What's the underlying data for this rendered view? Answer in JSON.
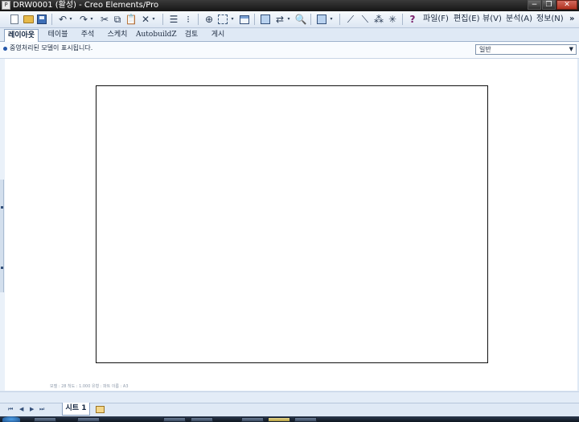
{
  "window": {
    "title": "DRW0001 (활성) - Creo Elements/Pro",
    "app_icon_text": "P",
    "buttons": {
      "minimize": "−",
      "restore": "❐",
      "close": "✕"
    }
  },
  "toolbar": {
    "icons": [
      "new-icon",
      "open-icon",
      "save-icon",
      "undo-icon",
      "redo-icon",
      "cut-icon",
      "copy-icon",
      "paste-icon",
      "delete-icon",
      "layer-icon",
      "tree-icon",
      "find-icon",
      "select-box-icon",
      "window-icon",
      "regenerate-icon",
      "repaint-icon",
      "zoom-icon",
      "display-style-icon",
      "datum-plane-icon",
      "datum-axis-icon",
      "datum-point-icon",
      "datum-csys-icon",
      "help-icon"
    ],
    "menus": [
      "파일(F)",
      "편집(E)",
      "뷰(V)",
      "분석(A)",
      "정보(N)"
    ],
    "more": "»"
  },
  "tabs": [
    {
      "label": "레이아웃",
      "active": true
    },
    {
      "label": "테이블",
      "active": false
    },
    {
      "label": "주석",
      "active": false
    },
    {
      "label": "스케치",
      "active": false
    },
    {
      "label": "AutobuildZ",
      "active": false
    },
    {
      "label": "검토",
      "active": false
    },
    {
      "label": "게시",
      "active": false
    }
  ],
  "message": "중영처리된 모델이 표시됩니다.",
  "filter": {
    "value": "일반"
  },
  "status_info": "모델 : 28  척도 : 1.000  유형 : 파트  이름 : A3",
  "sheet": {
    "tab_label": "시트 1"
  },
  "sheet_nav": [
    "⏮",
    "◀",
    "▶",
    "⏭"
  ],
  "colors": {
    "accent": "#2456a8",
    "chrome": "#dfe9f5",
    "canvas": "#ffffff"
  }
}
